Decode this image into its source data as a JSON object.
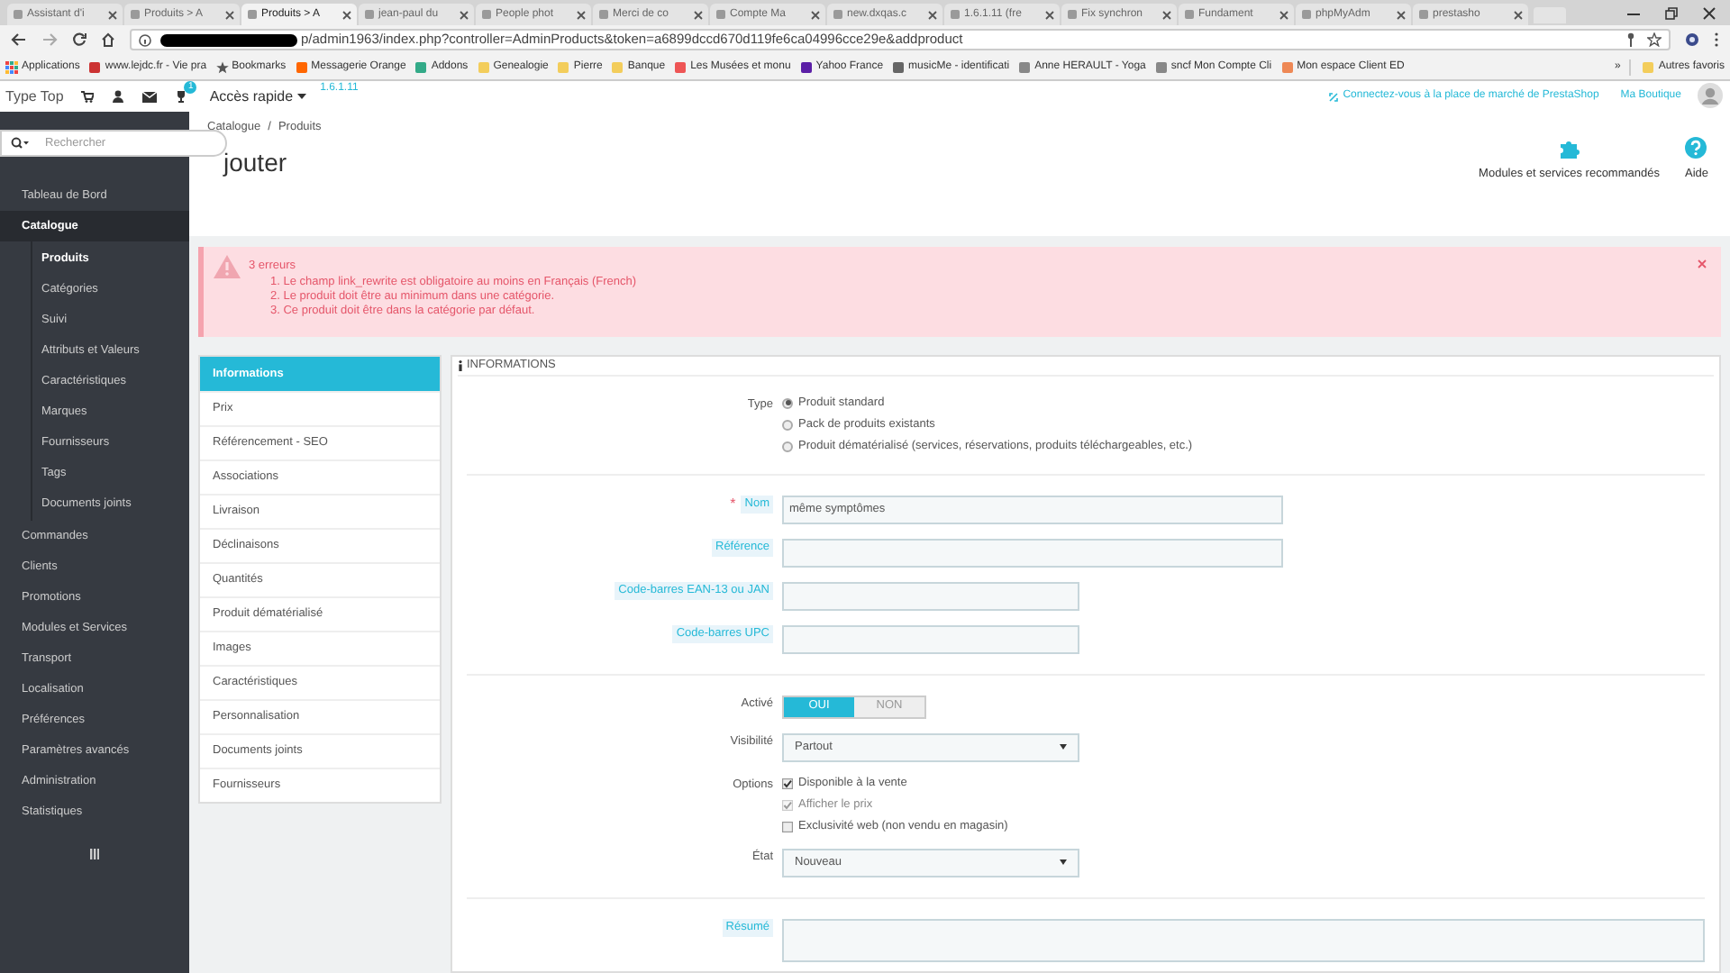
{
  "browser": {
    "tabs": [
      {
        "title": "Assistant d'i",
        "selected": false
      },
      {
        "title": "Produits > A",
        "selected": false
      },
      {
        "title": "Produits > A",
        "selected": true
      },
      {
        "title": "jean-paul du",
        "selected": false
      },
      {
        "title": "People phot",
        "selected": false
      },
      {
        "title": "Merci de co",
        "selected": false
      },
      {
        "title": "Compte Ma",
        "selected": false
      },
      {
        "title": "new.dxqas.c",
        "selected": false
      },
      {
        "title": "1.6.1.11 (fre",
        "selected": false
      },
      {
        "title": "Fix synchron",
        "selected": false
      },
      {
        "title": "Fundament",
        "selected": false
      },
      {
        "title": "phpMyAdm",
        "selected": false
      },
      {
        "title": "prestasho",
        "selected": false
      }
    ],
    "url": "p/admin1963/index.php?controller=AdminProducts&token=a6899dccd670d119fe6ca04996cce29e&addproduct",
    "bookmarks": [
      "Applications",
      "www.lejdc.fr - Vie pra",
      "Bookmarks",
      "Messagerie Orange",
      "Addons",
      "Genealogie",
      "Pierre",
      "Banque",
      "Les Musées et monu",
      "Yahoo France",
      "musicMe - identificati",
      "Anne HERAULT - Yoga",
      "sncf Mon Compte Cli",
      "Mon espace Client ED"
    ],
    "more": "»",
    "other_bookmarks": "Autres favoris"
  },
  "topbar": {
    "shop": "Type Top",
    "badge": "1",
    "quick_access": "Accès rapide",
    "version": "1.6.1.11",
    "marketplace": "Connectez-vous à la place de marché de PrestaShop",
    "my_shop": "Ma Boutique"
  },
  "search": {
    "placeholder": "Rechercher"
  },
  "sidebar": {
    "items": [
      {
        "label": "Tableau de Bord",
        "selected": false
      },
      {
        "label": "Catalogue",
        "selected": true,
        "children": [
          {
            "label": "Produits",
            "selected": true
          },
          {
            "label": "Catégories",
            "selected": false
          },
          {
            "label": "Suivi",
            "selected": false
          },
          {
            "label": "Attributs et Valeurs",
            "selected": false
          },
          {
            "label": "Caractéristiques",
            "selected": false
          },
          {
            "label": "Marques",
            "selected": false
          },
          {
            "label": "Fournisseurs",
            "selected": false
          },
          {
            "label": "Tags",
            "selected": false
          },
          {
            "label": "Documents joints",
            "selected": false
          }
        ]
      },
      {
        "label": "Commandes",
        "selected": false
      },
      {
        "label": "Clients",
        "selected": false
      },
      {
        "label": "Promotions",
        "selected": false
      },
      {
        "label": "Modules et Services",
        "selected": false
      },
      {
        "label": "Transport",
        "selected": false
      },
      {
        "label": "Localisation",
        "selected": false
      },
      {
        "label": "Préférences",
        "selected": false
      },
      {
        "label": "Paramètres avancés",
        "selected": false
      },
      {
        "label": "Administration",
        "selected": false
      },
      {
        "label": "Statistiques",
        "selected": false
      }
    ]
  },
  "header": {
    "breadcrumb": [
      "Catalogue",
      "Produits"
    ],
    "separator": "/",
    "title": "jouter",
    "toolbar": [
      {
        "kind": "modules",
        "label": "Modules et services recommandés"
      },
      {
        "kind": "help",
        "label": "Aide"
      }
    ]
  },
  "alert": {
    "title": "3 erreurs",
    "messages": [
      "1. Le champ link_rewrite est obligatoire au moins en Français (French)",
      "2. Le produit doit être au minimum dans une catégorie.",
      "3. Ce produit doit être dans la catégorie par défaut."
    ]
  },
  "product_tabs": [
    {
      "label": "Informations",
      "selected": true
    },
    {
      "label": "Prix",
      "selected": false
    },
    {
      "label": "Référencement - SEO",
      "selected": false
    },
    {
      "label": "Associations",
      "selected": false
    },
    {
      "label": "Livraison",
      "selected": false
    },
    {
      "label": "Déclinaisons",
      "selected": false
    },
    {
      "label": "Quantités",
      "selected": false
    },
    {
      "label": "Produit dématérialisé",
      "selected": false
    },
    {
      "label": "Images",
      "selected": false
    },
    {
      "label": "Caractéristiques",
      "selected": false
    },
    {
      "label": "Personnalisation",
      "selected": false
    },
    {
      "label": "Documents joints",
      "selected": false
    },
    {
      "label": "Fournisseurs",
      "selected": false
    }
  ],
  "panel": {
    "title": "INFORMATIONS",
    "sections": [
      [
        {
          "kind": "radio",
          "label": "Type",
          "options": [
            {
              "label": "Produit standard",
              "selected": true
            },
            {
              "label": "Pack de produits existants",
              "selected": false
            },
            {
              "label": "Produit dématérialisé (services, réservations, produits téléchargeables, etc.)",
              "selected": false
            }
          ]
        }
      ],
      [
        {
          "kind": "text",
          "label": "Nom",
          "required_mark": "*",
          "hint": true,
          "value": "même symptômes",
          "wide": true
        },
        {
          "kind": "text",
          "label": "Référence",
          "hint": true,
          "wide": true
        },
        {
          "kind": "text",
          "label": "Code-barres EAN-13 ou JAN",
          "hint": true,
          "wide": false
        },
        {
          "kind": "text",
          "label": "Code-barres UPC",
          "hint": true,
          "wide": false
        }
      ],
      [
        {
          "kind": "toggle",
          "label": "Activé",
          "options": [
            {
              "label": "OUI",
              "selected": true
            },
            {
              "label": "NON",
              "selected": false
            }
          ]
        },
        {
          "kind": "select",
          "label": "Visibilité",
          "value": "Partout"
        },
        {
          "kind": "checkbox",
          "label": "Options",
          "options": [
            {
              "label": "Disponible à la vente",
              "checked": true,
              "disabled": false
            },
            {
              "label": "Afficher le prix",
              "checked": true,
              "disabled": true
            },
            {
              "label": "Exclusivité web (non vendu en magasin)",
              "checked": false,
              "disabled": false
            }
          ]
        },
        {
          "kind": "select",
          "label": "État",
          "value": "Nouveau"
        }
      ],
      [
        {
          "kind": "textarea",
          "label": "Résumé",
          "hint": true
        }
      ]
    ]
  }
}
